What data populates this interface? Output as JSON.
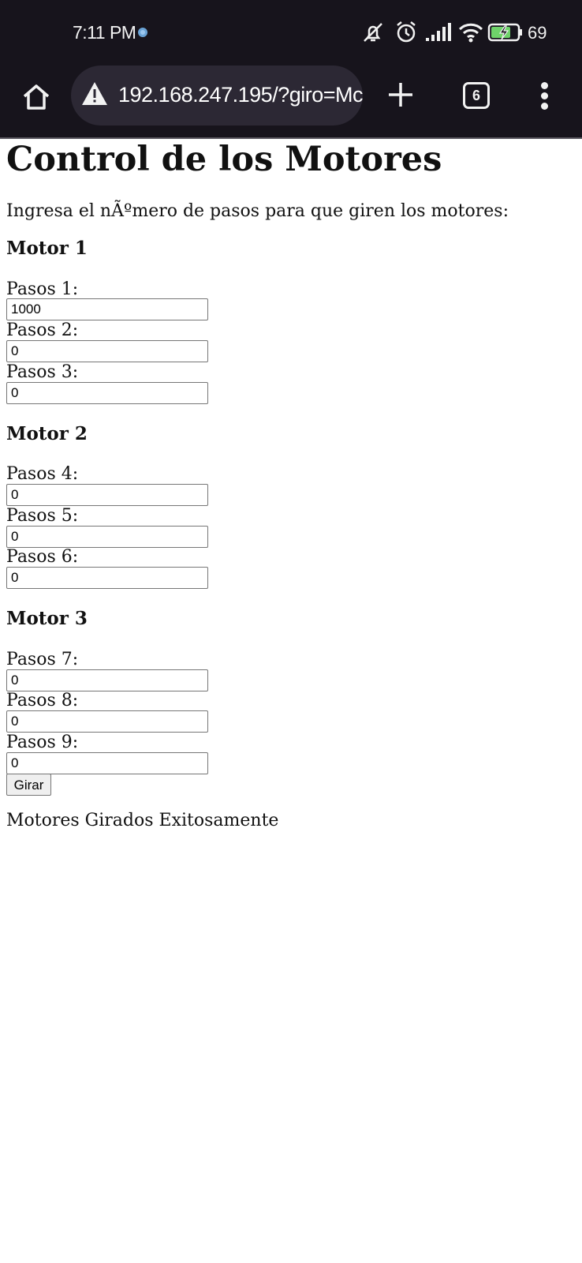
{
  "status_bar": {
    "time": "7:11 PM",
    "battery_level": "69",
    "icons": [
      "sync-dot-icon",
      "mute-icon",
      "alarm-icon",
      "signal-icon",
      "wifi-icon",
      "battery-charging-icon"
    ]
  },
  "browser": {
    "url": "192.168.247.195/?giro=Mc",
    "tab_count": "6",
    "icons": [
      "home-icon",
      "warning-icon",
      "plus-icon",
      "tabs-icon",
      "more-vert-icon"
    ]
  },
  "page": {
    "title": "Control de los Motores",
    "intro": "Ingresa el nÃºmero de pasos para que giren los motores:",
    "motors": [
      {
        "title": "Motor 1",
        "fields": [
          {
            "label": "Pasos 1:",
            "value": "1000"
          },
          {
            "label": "Pasos 2:",
            "value": "0"
          },
          {
            "label": "Pasos 3:",
            "value": "0"
          }
        ]
      },
      {
        "title": "Motor 2",
        "fields": [
          {
            "label": "Pasos 4:",
            "value": "0"
          },
          {
            "label": "Pasos 5:",
            "value": "0"
          },
          {
            "label": "Pasos 6:",
            "value": "0"
          }
        ]
      },
      {
        "title": "Motor 3",
        "fields": [
          {
            "label": "Pasos 7:",
            "value": "0"
          },
          {
            "label": "Pasos 8:",
            "value": "0"
          },
          {
            "label": "Pasos 9:",
            "value": "0"
          }
        ]
      }
    ],
    "submit_label": "Girar",
    "result": "Motores Girados Exitosamente"
  }
}
